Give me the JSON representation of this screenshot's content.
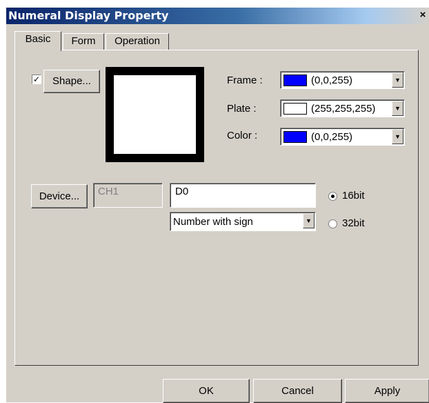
{
  "window": {
    "title": "Numeral Display Property",
    "close_glyph": "×"
  },
  "tabs": [
    {
      "label": "Basic",
      "active": true
    },
    {
      "label": "Form",
      "active": false
    },
    {
      "label": "Operation",
      "active": false
    }
  ],
  "shape": {
    "checkbox_checked": true,
    "check_glyph": "✓",
    "button_label": "Shape..."
  },
  "colors": {
    "frame": {
      "label": "Frame :",
      "value": "(0,0,255)",
      "swatch": "#0000ff"
    },
    "plate": {
      "label": "Plate :",
      "value": "(255,255,255)",
      "swatch": "#ffffff"
    },
    "color": {
      "label": "Color :",
      "value": "(0,0,255)",
      "swatch": "#0000ff"
    }
  },
  "preview": {
    "frame_color": "#000000",
    "plate_color": "#ffffff"
  },
  "device": {
    "button_label": "Device...",
    "channel_value": "CH1",
    "address_value": "D0",
    "number_format": "Number with sign",
    "bit_options": [
      {
        "label": "16bit",
        "selected": true
      },
      {
        "label": "32bit",
        "selected": false
      }
    ]
  },
  "footer": {
    "ok_label": "OK",
    "cancel_label": "Cancel",
    "apply_label": "Apply"
  }
}
